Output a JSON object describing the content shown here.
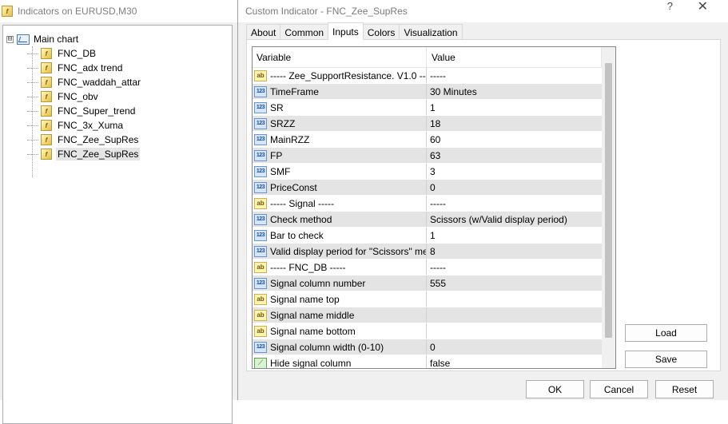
{
  "back_window": {
    "title": "Indicators on EURUSD,M30",
    "tree": {
      "root_label": "Main chart",
      "expander": "⊟",
      "items": [
        {
          "label": "FNC_DB",
          "icon": "indicator-icon"
        },
        {
          "label": "FNC_adx trend",
          "icon": "indicator-icon"
        },
        {
          "label": "FNC_waddah_attar",
          "icon": "indicator-icon"
        },
        {
          "label": "FNC_obv",
          "icon": "indicator-icon"
        },
        {
          "label": "FNC_Super_trend",
          "icon": "indicator-icon"
        },
        {
          "label": "FNC_3x_Xuma",
          "icon": "indicator-icon"
        },
        {
          "label": "FNC_Zee_SupRes",
          "icon": "indicator-icon"
        },
        {
          "label": "FNC_Zee_SupRes",
          "icon": "indicator-icon",
          "selected": true
        }
      ]
    }
  },
  "dialog": {
    "title": "Custom Indicator - FNC_Zee_SupRes",
    "help": "?",
    "close": "✕",
    "tabs": [
      "About",
      "Common",
      "Inputs",
      "Colors",
      "Visualization"
    ],
    "active_tab": "Inputs",
    "grid": {
      "headers": {
        "variable": "Variable",
        "value": "Value"
      },
      "rows": [
        {
          "type": "str",
          "variable": "----- Zee_SupportResistance. V1.0 -----",
          "value": "-----"
        },
        {
          "type": "num",
          "variable": "TimeFrame",
          "value": "30 Minutes"
        },
        {
          "type": "num",
          "variable": "SR",
          "value": "1"
        },
        {
          "type": "num",
          "variable": "SRZZ",
          "value": "18"
        },
        {
          "type": "num",
          "variable": "MainRZZ",
          "value": "60"
        },
        {
          "type": "num",
          "variable": "FP",
          "value": "63"
        },
        {
          "type": "num",
          "variable": "SMF",
          "value": "3"
        },
        {
          "type": "num",
          "variable": "PriceConst",
          "value": "0"
        },
        {
          "type": "str",
          "variable": "----- Signal -----",
          "value": "-----"
        },
        {
          "type": "num",
          "variable": "Check method",
          "value": "Scissors (w/Valid display period)"
        },
        {
          "type": "num",
          "variable": "Bar to check",
          "value": "1"
        },
        {
          "type": "num",
          "variable": "Valid display period for \"Scissors\" met...",
          "value": "8"
        },
        {
          "type": "str",
          "variable": "----- FNC_DB -----",
          "value": "-----"
        },
        {
          "type": "num",
          "variable": "Signal column number",
          "value": "555"
        },
        {
          "type": "str",
          "variable": "Signal name top",
          "value": ""
        },
        {
          "type": "str",
          "variable": "Signal name middle",
          "value": ""
        },
        {
          "type": "str",
          "variable": "Signal name bottom",
          "value": ""
        },
        {
          "type": "num",
          "variable": "Signal column width (0-10)",
          "value": "0"
        },
        {
          "type": "bool",
          "variable": "Hide signal column",
          "value": "false"
        }
      ],
      "type_icon_text": {
        "num": "123",
        "str": "ab",
        "bool": "⟋"
      }
    },
    "buttons": {
      "load": "Load",
      "save": "Save",
      "ok": "OK",
      "cancel": "Cancel",
      "reset": "Reset"
    }
  }
}
